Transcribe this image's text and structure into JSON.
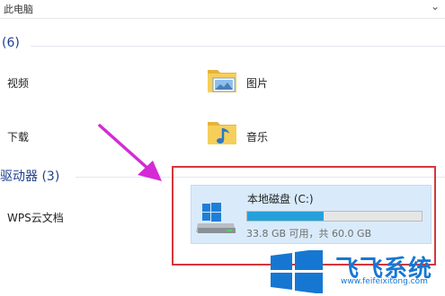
{
  "address_bar": {
    "path": "此电脑",
    "dropdown_icon": "chevron-down-icon"
  },
  "folders_group": {
    "header": "(6)",
    "items": [
      {
        "label": "视频",
        "icon": "video-folder-icon"
      },
      {
        "label": "图片",
        "icon": "pictures-folder-icon"
      },
      {
        "label": "下载",
        "icon": "downloads-folder-icon"
      },
      {
        "label": "音乐",
        "icon": "music-folder-icon"
      }
    ]
  },
  "drives_group": {
    "header": "驱动器 (3)",
    "items": [
      {
        "label": "WPS云文档"
      }
    ],
    "drive": {
      "name": "本地磁盘 (C:)",
      "free_text": "33.8 GB 可用，共 60.0 GB",
      "used_fraction": 0.437,
      "icon": "windows-drive-icon"
    }
  },
  "annotation": {
    "arrow_color": "#d42bd6",
    "highlight_color": "#d7363b"
  },
  "watermark": {
    "title": "飞飞系统",
    "subtitle": "www.feifeixitong.com",
    "color": "#1677d2"
  }
}
